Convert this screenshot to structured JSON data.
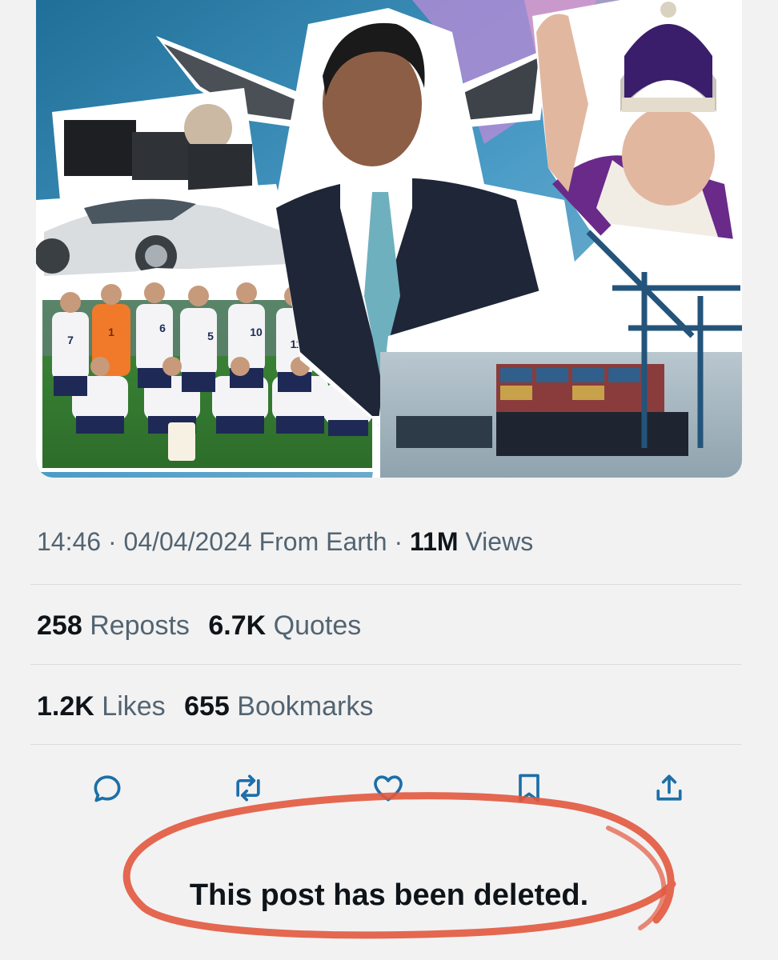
{
  "tweet": {
    "time": "14:46",
    "separator": "·",
    "date": "04/04/2024",
    "source": "From Earth",
    "views_count": "11M",
    "views_label": "Views"
  },
  "engagement": {
    "reposts_count": "258",
    "reposts_label": "Reposts",
    "quotes_count": "6.7K",
    "quotes_label": "Quotes",
    "likes_count": "1.2K",
    "likes_label": "Likes",
    "bookmarks_count": "655",
    "bookmarks_label": "Bookmarks"
  },
  "actions": [
    {
      "name": "reply",
      "icon": "reply-icon"
    },
    {
      "name": "repost",
      "icon": "repost-icon"
    },
    {
      "name": "like",
      "icon": "heart-icon"
    },
    {
      "name": "bookmark",
      "icon": "bookmark-icon"
    },
    {
      "name": "share",
      "icon": "share-icon"
    }
  ],
  "notice": {
    "text": "This post has been deleted.",
    "highlight_color": "#e2583e"
  },
  "media": {
    "jersey_numbers": [
      "7",
      "1",
      "6",
      "5",
      "10",
      "11"
    ]
  },
  "colors": {
    "icon": "#1d6fa8",
    "text_primary": "#0f1419",
    "text_secondary": "#536471",
    "background": "#f2f2f3"
  }
}
